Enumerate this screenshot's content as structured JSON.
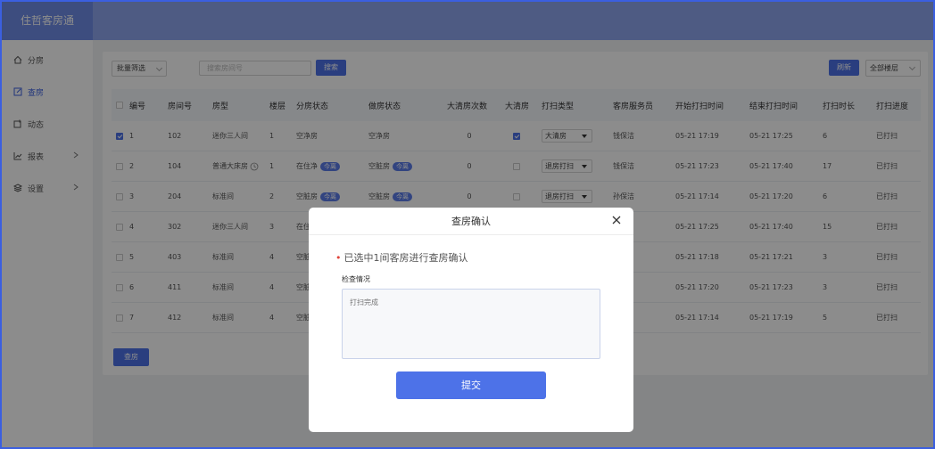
{
  "app": {
    "title": "住哲客房通"
  },
  "sidebar": {
    "items": [
      {
        "label": "分房",
        "icon": "home-icon",
        "active": false,
        "has_arrow": false
      },
      {
        "label": "查房",
        "icon": "edit-icon",
        "active": true,
        "has_arrow": false
      },
      {
        "label": "动态",
        "icon": "note-icon",
        "active": false,
        "has_arrow": false
      },
      {
        "label": "报表",
        "icon": "chart-icon",
        "active": false,
        "has_arrow": true
      },
      {
        "label": "设置",
        "icon": "layers-icon",
        "active": false,
        "has_arrow": true
      }
    ]
  },
  "toolbar": {
    "batch_filter": "批量筛选",
    "search_placeholder": "搜索房间号",
    "search_label": "搜索",
    "refresh_label": "刷新",
    "floor_select": "全部楼层"
  },
  "table": {
    "columns": [
      "编号",
      "房间号",
      "房型",
      "楼层",
      "分房状态",
      "做房状态",
      "大清房次数",
      "大清房",
      "打扫类型",
      "客房服务员",
      "开始打扫时间",
      "结束打扫时间",
      "打扫时长",
      "打扫进度"
    ],
    "rows": [
      {
        "checked": true,
        "no": "1",
        "room": "102",
        "type": "迷你三人间",
        "clock": false,
        "floor": "1",
        "assign": "空净房",
        "assign_tag": "",
        "work": "空净房",
        "work_tag": "",
        "clean_count": "0",
        "deep": true,
        "clean_type": "大清房",
        "staff": "钱保洁",
        "start": "05-21 17:19",
        "end": "05-21 17:25",
        "duration": "6",
        "progress": "已打扫"
      },
      {
        "checked": false,
        "no": "2",
        "room": "104",
        "type": "普通大床房",
        "clock": true,
        "floor": "1",
        "assign": "在住净",
        "assign_tag": "今离",
        "work": "空脏房",
        "work_tag": "今离",
        "clean_count": "0",
        "deep": false,
        "clean_type": "退房打扫",
        "staff": "钱保洁",
        "start": "05-21 17:23",
        "end": "05-21 17:40",
        "duration": "17",
        "progress": "已打扫"
      },
      {
        "checked": false,
        "no": "3",
        "room": "204",
        "type": "标准间",
        "clock": false,
        "floor": "2",
        "assign": "空脏房",
        "assign_tag": "今离",
        "work": "空脏房",
        "work_tag": "今离",
        "clean_count": "0",
        "deep": false,
        "clean_type": "退房打扫",
        "staff": "孙保洁",
        "start": "05-21 17:14",
        "end": "05-21 17:20",
        "duration": "6",
        "progress": "已打扫"
      },
      {
        "checked": false,
        "no": "4",
        "room": "302",
        "type": "迷你三人间",
        "clock": false,
        "floor": "3",
        "assign": "在住",
        "assign_tag": "",
        "work": "",
        "work_tag": "",
        "clean_count": "",
        "deep": null,
        "clean_type": "",
        "staff": "",
        "start": "05-21 17:25",
        "end": "05-21 17:40",
        "duration": "15",
        "progress": "已打扫"
      },
      {
        "checked": false,
        "no": "5",
        "room": "403",
        "type": "标准间",
        "clock": false,
        "floor": "4",
        "assign": "空脏",
        "assign_tag": "",
        "work": "",
        "work_tag": "",
        "clean_count": "",
        "deep": null,
        "clean_type": "",
        "staff": "",
        "start": "05-21 17:18",
        "end": "05-21 17:21",
        "duration": "3",
        "progress": "已打扫"
      },
      {
        "checked": false,
        "no": "6",
        "room": "411",
        "type": "标准间",
        "clock": false,
        "floor": "4",
        "assign": "空脏",
        "assign_tag": "",
        "work": "",
        "work_tag": "",
        "clean_count": "",
        "deep": null,
        "clean_type": "",
        "staff": "",
        "start": "05-21 17:20",
        "end": "05-21 17:23",
        "duration": "3",
        "progress": "已打扫"
      },
      {
        "checked": false,
        "no": "7",
        "room": "412",
        "type": "标准间",
        "clock": false,
        "floor": "4",
        "assign": "空脏",
        "assign_tag": "",
        "work": "",
        "work_tag": "",
        "clean_count": "",
        "deep": null,
        "clean_type": "",
        "staff": "",
        "start": "05-21 17:14",
        "end": "05-21 17:19",
        "duration": "5",
        "progress": "已打扫"
      }
    ]
  },
  "checkout_label": "查房",
  "modal": {
    "title": "查房确认",
    "message": "已选中1间客房进行查房确认",
    "field_label": "检查情况",
    "textarea_placeholder": "打扫完成",
    "submit_label": "提交"
  },
  "colors": {
    "accent": "#4d72e8",
    "header": "#8fa6ef",
    "brand": "#6f8ce8",
    "required": "#e0443a"
  }
}
